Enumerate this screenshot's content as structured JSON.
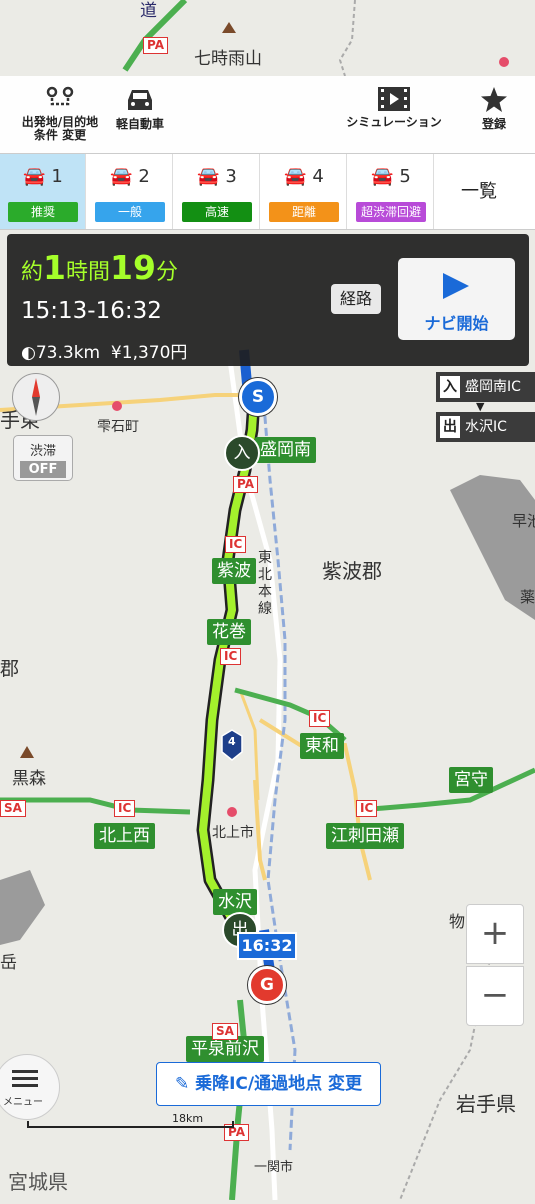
{
  "map_labels": {
    "nanashigure": "七時雨山",
    "shizukuishi": "雫石町",
    "shiwa_gun": "紫波郡",
    "tohoku_line": "東北本線",
    "kurumori": "黒森",
    "kitakami_city": "北上市",
    "iwate_pref": "岩手県",
    "miyagi_pref": "宮城県",
    "ichinoseki": "一関市",
    "te_higashi": "手東",
    "bu": "郡",
    "hayachine": "早池",
    "dake": "岳",
    "mono": "物",
    "sai": "薬",
    "route_num": "4",
    "michi": "道"
  },
  "green_tags": {
    "moriokaminami": "盛岡南",
    "shiwa": "紫波",
    "hanamaki": "花巻",
    "towa": "東和",
    "miyamori": "宮守",
    "kitakami_nishi": "北上西",
    "esashi": "江刺田瀬",
    "mizusawa": "水沢",
    "hiraizumi": "平泉前沢"
  },
  "ic_tags": {
    "pa": "PA",
    "ic": "IC",
    "sa": "SA"
  },
  "toolbar": {
    "start_goal": "出発地/目的地",
    "condition": "条件 変更",
    "vehicle": "軽自動車",
    "simulation": "シミュレーション",
    "register": "登録"
  },
  "tabs": [
    {
      "num": "1",
      "label": "推奨",
      "color": "#2bab2b"
    },
    {
      "num": "2",
      "label": "一般",
      "color": "#36a4ec"
    },
    {
      "num": "3",
      "label": "高速",
      "color": "#138f13"
    },
    {
      "num": "4",
      "label": "距離",
      "color": "#f39219"
    },
    {
      "num": "5",
      "label": "超渋滞回避",
      "color": "#b84bd8"
    }
  ],
  "tab_all": "一覧",
  "summary": {
    "approx": "約",
    "hours": "1",
    "hour_unit": "時間",
    "minutes": "19",
    "min_unit": "分",
    "time_range": "15:13-16:32",
    "distance": "73.3km",
    "toll": "1,370円",
    "route_button": "経路",
    "navi_button": "ナビ開始"
  },
  "ic_info": {
    "entry_key": "入",
    "entry_name": "盛岡南IC",
    "arrow": "▼",
    "exit_key": "出",
    "exit_name": "水沢IC"
  },
  "traffic": {
    "label": "渋滞",
    "state": "OFF"
  },
  "markers": {
    "start": "S",
    "goal": "G",
    "entry": "入",
    "exit": "出",
    "arrival_time": "16:32"
  },
  "scale": "18km",
  "menu_label": "メニュー",
  "ic_change_label": "乗降IC/通過地点 変更",
  "zoom": {
    "in": "+",
    "out": "−"
  },
  "accent": {
    "route_green": "#a4f12c",
    "navi_blue": "#1a6ad8"
  }
}
